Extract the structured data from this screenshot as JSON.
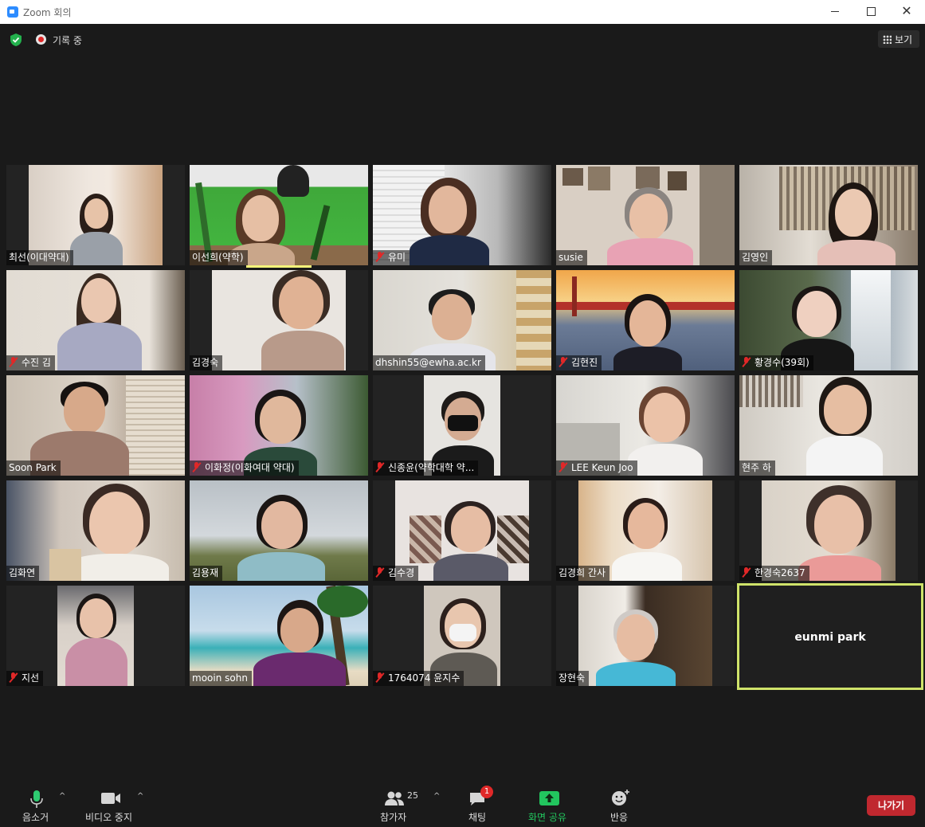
{
  "window": {
    "title": "Zoom 회의"
  },
  "topbar": {
    "recording_label": "기록 중",
    "view_label": "보기"
  },
  "participants": [
    {
      "name": "최선(이대약대)",
      "muted": false
    },
    {
      "name": "이선희(약학)",
      "muted": false
    },
    {
      "name": "유미",
      "muted": true
    },
    {
      "name": "susie",
      "muted": false
    },
    {
      "name": "김영인",
      "muted": false
    },
    {
      "name": "수진 김",
      "muted": true
    },
    {
      "name": "김경숙",
      "muted": false
    },
    {
      "name": "dhshin55@ewha.ac.kr",
      "muted": false
    },
    {
      "name": "김현진",
      "muted": true
    },
    {
      "name": "황경수(39회)",
      "muted": true
    },
    {
      "name": "Soon Park",
      "muted": false
    },
    {
      "name": "이화정(이화여대 약대)",
      "muted": true
    },
    {
      "name": "신종윤(약학대학 약...",
      "muted": true
    },
    {
      "name": "LEE Keun Joo",
      "muted": true
    },
    {
      "name": "현주 하",
      "muted": false
    },
    {
      "name": "김화연",
      "muted": false
    },
    {
      "name": "김용재",
      "muted": false
    },
    {
      "name": "김수경",
      "muted": true
    },
    {
      "name": "김경희 간사",
      "muted": false
    },
    {
      "name": "한경숙2637",
      "muted": true
    },
    {
      "name": "지선",
      "muted": true
    },
    {
      "name": "mooin sohn",
      "muted": false
    },
    {
      "name": "1764074 윤지수",
      "muted": true
    },
    {
      "name": "장현숙",
      "muted": false
    }
  ],
  "active_speaker": {
    "name": "eunmi park"
  },
  "toolbar": {
    "mute_label": "음소거",
    "video_label": "비디오 중지",
    "participants_label": "참가자",
    "participants_count": "25",
    "chat_label": "채팅",
    "chat_badge": "1",
    "share_label": "화면 공유",
    "reactions_label": "반응",
    "leave_label": "나가기"
  },
  "colors": {
    "accent_green": "#22c55e",
    "leave_red": "#c0282f",
    "active_border": "#cfe36a"
  }
}
